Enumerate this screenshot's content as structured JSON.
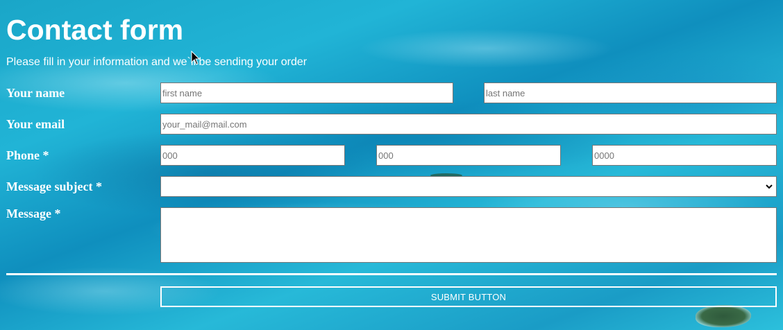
{
  "page": {
    "title": "Contact form",
    "subtitle": "Please fill in your information and we`ll be sending your order"
  },
  "form": {
    "name": {
      "label": "Your name",
      "first_placeholder": "first name",
      "last_placeholder": "last name"
    },
    "email": {
      "label": "Your email",
      "placeholder": "your_mail@mail.com"
    },
    "phone": {
      "label": "Phone *",
      "part1_placeholder": "000",
      "part2_placeholder": "000",
      "part3_placeholder": "0000"
    },
    "subject": {
      "label": "Message subject *",
      "selected_value": ""
    },
    "message": {
      "label": "Message *",
      "value": ""
    },
    "submit_label": "SUBMIT BUTTON"
  },
  "icons": {
    "select_arrow": "chevron-down-icon",
    "cursor": "mouse-pointer-icon"
  },
  "colors": {
    "text": "#ffffff",
    "field_border": "#767676",
    "field_background": "#ffffff",
    "water": "#1aa6c8"
  }
}
